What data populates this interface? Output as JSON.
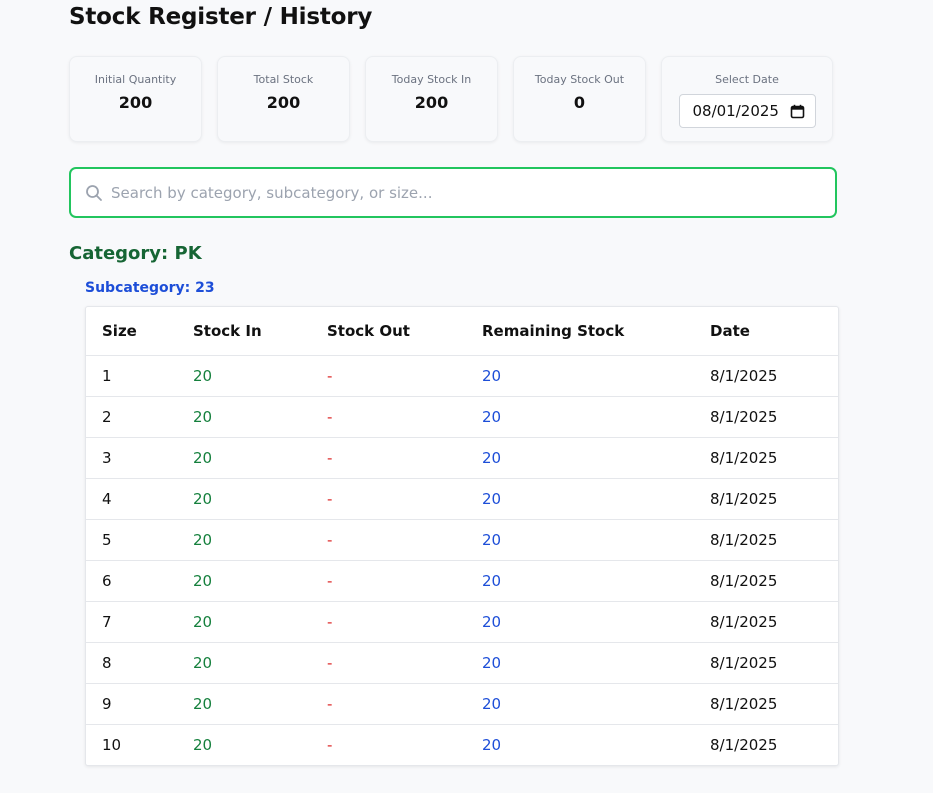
{
  "header": {
    "title": "Stock Register / History"
  },
  "summary": {
    "initial_quantity_label": "Initial Quantity",
    "initial_quantity_value": "200",
    "total_stock_label": "Total Stock",
    "total_stock_value": "200",
    "today_in_label": "Today Stock In",
    "today_in_value": "200",
    "today_out_label": "Today Stock Out",
    "today_out_value": "0",
    "select_date_label": "Select Date",
    "select_date_value": "08/01/2025"
  },
  "search": {
    "placeholder": "Search by category, subcategory, or size...",
    "value": ""
  },
  "category": {
    "title": "Category: PK",
    "subcategory_title": "Subcategory: 23"
  },
  "table": {
    "headers": [
      "Size",
      "Stock In",
      "Stock Out",
      "Remaining Stock",
      "Date"
    ],
    "rows": [
      {
        "size": "1",
        "stock_in": "20",
        "stock_out": "-",
        "remaining": "20",
        "date": "8/1/2025"
      },
      {
        "size": "2",
        "stock_in": "20",
        "stock_out": "-",
        "remaining": "20",
        "date": "8/1/2025"
      },
      {
        "size": "3",
        "stock_in": "20",
        "stock_out": "-",
        "remaining": "20",
        "date": "8/1/2025"
      },
      {
        "size": "4",
        "stock_in": "20",
        "stock_out": "-",
        "remaining": "20",
        "date": "8/1/2025"
      },
      {
        "size": "5",
        "stock_in": "20",
        "stock_out": "-",
        "remaining": "20",
        "date": "8/1/2025"
      },
      {
        "size": "6",
        "stock_in": "20",
        "stock_out": "-",
        "remaining": "20",
        "date": "8/1/2025"
      },
      {
        "size": "7",
        "stock_in": "20",
        "stock_out": "-",
        "remaining": "20",
        "date": "8/1/2025"
      },
      {
        "size": "8",
        "stock_in": "20",
        "stock_out": "-",
        "remaining": "20",
        "date": "8/1/2025"
      },
      {
        "size": "9",
        "stock_in": "20",
        "stock_out": "-",
        "remaining": "20",
        "date": "8/1/2025"
      },
      {
        "size": "10",
        "stock_in": "20",
        "stock_out": "-",
        "remaining": "20",
        "date": "8/1/2025"
      }
    ]
  },
  "colors": {
    "search_border": "#22c55e",
    "category_color": "#166534",
    "subcategory_color": "#1d4ed8",
    "stock_in_color": "#15803d",
    "stock_out_color": "#dc2626",
    "remaining_color": "#1d4ed8"
  }
}
